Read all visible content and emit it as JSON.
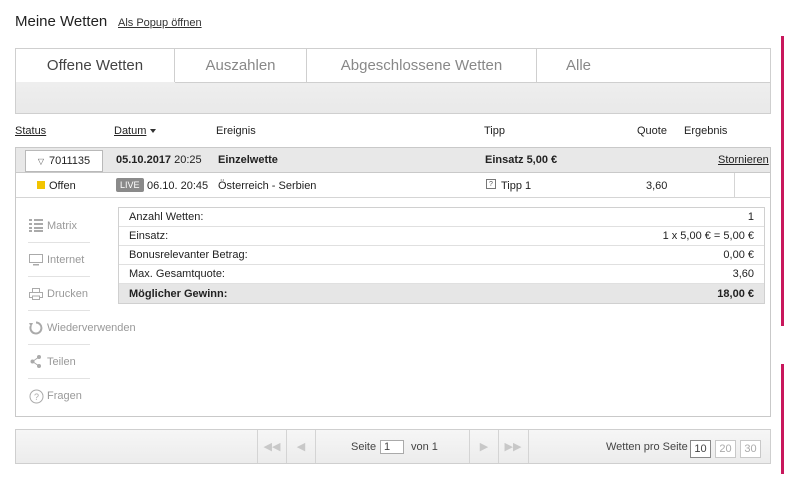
{
  "header": {
    "title": "Meine Wetten",
    "popup_link": "Als Popup öffnen"
  },
  "tabs": [
    {
      "label": "Offene Wetten",
      "active": true
    },
    {
      "label": "Auszahlen",
      "active": false
    },
    {
      "label": "Abgeschlossene Wetten",
      "active": false
    },
    {
      "label": "Alle",
      "active": false
    }
  ],
  "columns": {
    "status": "Status",
    "datum": "Datum",
    "ereignis": "Ereignis",
    "tipp": "Tipp",
    "quote": "Quote",
    "ergebnis": "Ergebnis"
  },
  "bet": {
    "id": "7011135",
    "date": "05.10.2017",
    "time": "20:25",
    "type": "Einzelwette",
    "stake": "Einsatz 5,00 €",
    "cancel_label": "Stornieren",
    "selection": {
      "status": "Offen",
      "live_badge": "LIVE",
      "event_datetime": "06.10. 20:45",
      "event": "Österreich - Serbien",
      "tip": "Tipp 1",
      "quote": "3,60"
    },
    "summary": [
      {
        "label": "Anzahl Wetten:",
        "value": "1"
      },
      {
        "label": "Einsatz:",
        "value": "1 x 5,00 € = 5,00 €"
      },
      {
        "label": "Bonusrelevanter Betrag:",
        "value": "0,00 €"
      },
      {
        "label": "Max. Gesamtquote:",
        "value": "3,60"
      },
      {
        "label": "Möglicher Gewinn:",
        "value": "18,00 €"
      }
    ]
  },
  "actions": [
    {
      "label": "Matrix",
      "icon": "matrix-icon"
    },
    {
      "label": "Internet",
      "icon": "monitor-icon"
    },
    {
      "label": "Drucken",
      "icon": "printer-icon"
    },
    {
      "label": "Wiederverwenden",
      "icon": "reuse-icon"
    },
    {
      "label": "Teilen",
      "icon": "share-icon"
    },
    {
      "label": "Fragen",
      "icon": "question-icon"
    }
  ],
  "pager": {
    "page_label": "Seite",
    "page_value": "1",
    "of_label": "von 1",
    "per_page_label": "Wetten pro Seite",
    "per_page_options": [
      "10",
      "20",
      "30"
    ],
    "per_page_selected": "10"
  },
  "colors": {
    "accent": "#c8175c",
    "status_open": "#f2c400"
  }
}
